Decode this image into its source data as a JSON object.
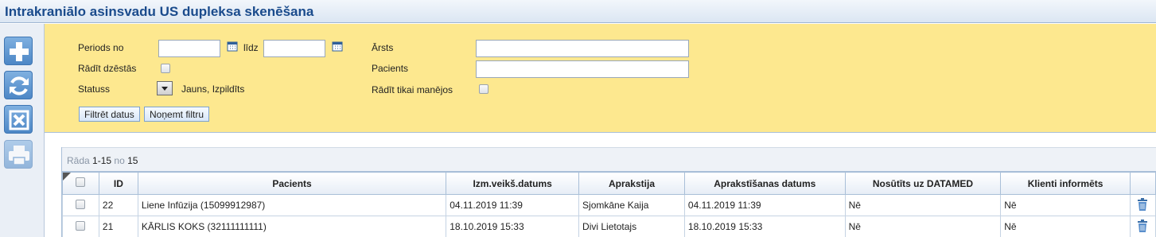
{
  "window": {
    "title": "Intrakraniālo asinsvadu US dupleksa skenēšana"
  },
  "toolbar": {
    "buttons": [
      {
        "icon": "plus-icon"
      },
      {
        "icon": "refresh-icon"
      },
      {
        "icon": "cancel-icon"
      },
      {
        "icon": "print-icon"
      }
    ]
  },
  "filter": {
    "period_from_label": "Periods no",
    "period_from_value": "",
    "period_to_label": "līdz",
    "period_to_value": "",
    "show_deleted_label": "Rādīt dzēstās",
    "status_label": "Statuss",
    "status_value": "Jauns, Izpildīts",
    "doctor_label": "Ārsts",
    "doctor_value": "",
    "patient_label": "Pacients",
    "patient_value": "",
    "only_mine_label": "Rādīt tikai manējos",
    "filter_button": "Filtrēt datus",
    "clear_button": "Noņemt filtru"
  },
  "pager": {
    "prefix": "Rāda",
    "range": "1-15",
    "of": "no",
    "total": "15"
  },
  "table": {
    "columns": [
      "ID",
      "Pacients",
      "Izm.veikš.datums",
      "Aprakstija",
      "Aprakstīšanas datums",
      "Nosūtīts uz DATAMED",
      "Klienti informēts"
    ],
    "rows": [
      {
        "id": "22",
        "patient": "Liene Infūzija (15099912987)",
        "date": "04.11.2019 11:39",
        "describer": "Sjomkāne Kaija",
        "described_date": "04.11.2019 11:39",
        "sent": "Nē",
        "informed": "Nē"
      },
      {
        "id": "21",
        "patient": "KĀRLIS KOKS (32111111111)",
        "date": "18.10.2019 15:33",
        "describer": "Divi Lietotajs",
        "described_date": "18.10.2019 15:33",
        "sent": "Nē",
        "informed": "Nē"
      }
    ]
  },
  "colors": {
    "accent": "#1a4b8c",
    "filter_bg": "#fde88f",
    "toolbar_btn": "#4d87c6"
  }
}
